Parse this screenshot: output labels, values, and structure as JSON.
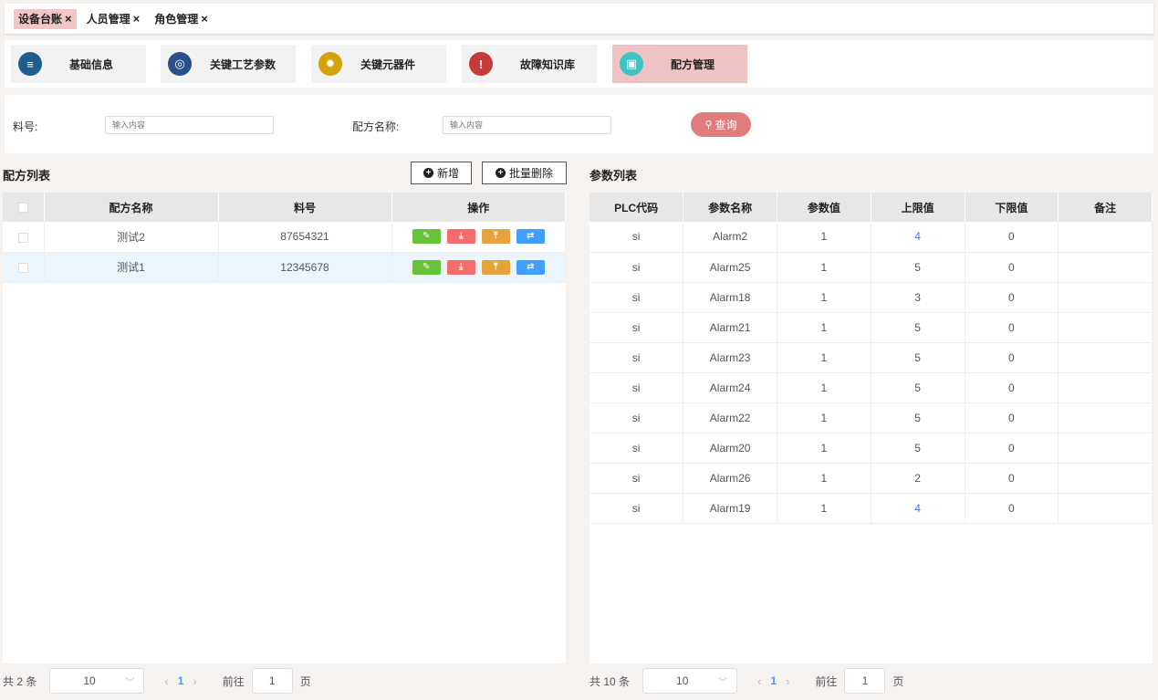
{
  "tabs": [
    {
      "label": "设备台账",
      "close": "×"
    },
    {
      "label": "人员管理",
      "close": "×"
    },
    {
      "label": "角色管理",
      "close": "×"
    }
  ],
  "modules": [
    {
      "label": "基础信息",
      "icon": "≡",
      "color": "#1e5e8c"
    },
    {
      "label": "关键工艺参数",
      "icon": "◎",
      "color": "#2b4f8a"
    },
    {
      "label": "关键元器件",
      "icon": "✹",
      "color": "#d4a20b"
    },
    {
      "label": "故障知识库",
      "icon": "!",
      "color": "#c53a3a"
    },
    {
      "label": "配方管理",
      "icon": "▣",
      "color": "#3cc3c3"
    }
  ],
  "search": {
    "material_label": "料号:",
    "material_placeholder": "输入内容",
    "recipe_label": "配方名称:",
    "recipe_placeholder": "输入内容",
    "query_button": "查询",
    "query_icon": "⚲"
  },
  "recipe_list": {
    "title": "配方列表",
    "add_button": "新增",
    "batch_delete_button": "批量删除",
    "columns": [
      "配方名称",
      "料号",
      "操作"
    ],
    "rows": [
      {
        "name": "测试2",
        "material": "87654321"
      },
      {
        "name": "测试1",
        "material": "12345678"
      }
    ],
    "op_icons": [
      "✎",
      "⤓",
      "⤒",
      "⇄"
    ],
    "total": "共 2 条",
    "page_size": "10",
    "current_page": "1",
    "goto_label": "前往",
    "goto_value": "1",
    "page_unit": "页"
  },
  "param_list": {
    "title": "参数列表",
    "columns": [
      "PLC代码",
      "参数名称",
      "参数值",
      "上限值",
      "下限值",
      "备注"
    ],
    "rows": [
      {
        "plc": "si",
        "name": "Alarm2",
        "value": "1",
        "upper": "4",
        "lower": "0",
        "note": ""
      },
      {
        "plc": "si",
        "name": "Alarm25",
        "value": "1",
        "upper": "5",
        "lower": "0",
        "note": ""
      },
      {
        "plc": "si",
        "name": "Alarm18",
        "value": "1",
        "upper": "3",
        "lower": "0",
        "note": ""
      },
      {
        "plc": "si",
        "name": "Alarm21",
        "value": "1",
        "upper": "5",
        "lower": "0",
        "note": ""
      },
      {
        "plc": "si",
        "name": "Alarm23",
        "value": "1",
        "upper": "5",
        "lower": "0",
        "note": ""
      },
      {
        "plc": "si",
        "name": "Alarm24",
        "value": "1",
        "upper": "5",
        "lower": "0",
        "note": ""
      },
      {
        "plc": "si",
        "name": "Alarm22",
        "value": "1",
        "upper": "5",
        "lower": "0",
        "note": ""
      },
      {
        "plc": "si",
        "name": "Alarm20",
        "value": "1",
        "upper": "5",
        "lower": "0",
        "note": ""
      },
      {
        "plc": "si",
        "name": "Alarm26",
        "value": "1",
        "upper": "2",
        "lower": "0",
        "note": ""
      },
      {
        "plc": "si",
        "name": "Alarm19",
        "value": "1",
        "upper": "4",
        "lower": "0",
        "note": ""
      }
    ],
    "total": "共 10 条",
    "page_size": "10",
    "current_page": "1",
    "goto_label": "前往",
    "goto_value": "1",
    "page_unit": "页"
  }
}
